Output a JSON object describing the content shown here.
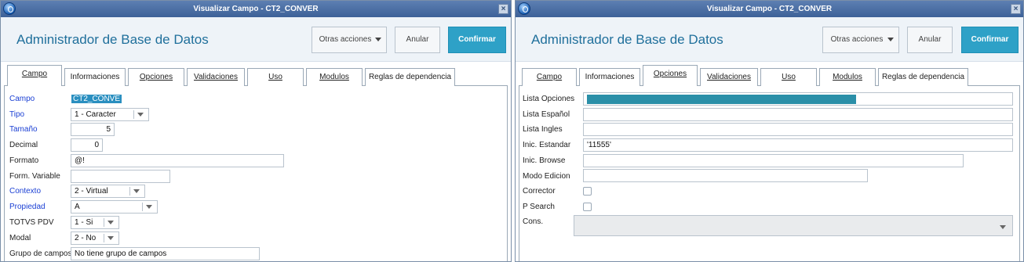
{
  "left": {
    "window_title": "Visualizar Campo - CT2_CONVER",
    "app_title": "Administrador de Base de Datos",
    "buttons": {
      "more": "Otras acciones",
      "cancel": "Anular",
      "confirm": "Confirmar"
    },
    "tabs": [
      "Campo",
      "Informaciones",
      "Opciones",
      "Validaciones",
      "Uso",
      "Modulos",
      "Reglas de dependencia"
    ],
    "active_tab": "Campo",
    "fields": {
      "campo": {
        "label": "Campo",
        "value": "CT2_CONVE"
      },
      "tipo": {
        "label": "Tipo",
        "value": "1 - Caracter"
      },
      "tamano": {
        "label": "Tamaño",
        "value": "5"
      },
      "decimal": {
        "label": "Decimal",
        "value": "0"
      },
      "formato": {
        "label": "Formato",
        "value": "@!"
      },
      "form_variable": {
        "label": "Form. Variable",
        "value": ""
      },
      "contexto": {
        "label": "Contexto",
        "value": "2 - Virtual"
      },
      "propiedad": {
        "label": "Propiedad",
        "value": "A"
      },
      "totvs_pdv": {
        "label": "TOTVS PDV",
        "value": "1 - Si"
      },
      "modal": {
        "label": "Modal",
        "value": "2 - No"
      },
      "grupo": {
        "label": "Grupo de campos",
        "value": "No tiene grupo de campos"
      }
    }
  },
  "right": {
    "window_title": "Visualizar Campo - CT2_CONVER",
    "app_title": "Administrador de Base de Datos",
    "buttons": {
      "more": "Otras acciones",
      "cancel": "Anular",
      "confirm": "Confirmar"
    },
    "tabs": [
      "Campo",
      "Informaciones",
      "Opciones",
      "Validaciones",
      "Uso",
      "Modulos",
      "Reglas de dependencia"
    ],
    "active_tab": "Opciones",
    "fields": {
      "lista_opciones": {
        "label": "Lista Opciones",
        "value": ""
      },
      "lista_espanol": {
        "label": "Lista Español",
        "value": ""
      },
      "lista_ingles": {
        "label": "Lista Ingles",
        "value": ""
      },
      "inic_estandar": {
        "label": "Inic. Estandar",
        "value": "'11555'"
      },
      "inic_browse": {
        "label": "Inic. Browse",
        "value": ""
      },
      "modo_edicion": {
        "label": "Modo Edicion",
        "value": ""
      },
      "corrector": {
        "label": "Corrector",
        "checked": false
      },
      "p_search": {
        "label": "P Search",
        "checked": false
      },
      "cons": {
        "label": "Cons.",
        "value": ""
      }
    }
  },
  "colors": {
    "title_bar": "#4a6fa5",
    "accent": "#2ea1c7",
    "label_blue": "#1a3fd4",
    "header_text": "#1f6f9b"
  }
}
